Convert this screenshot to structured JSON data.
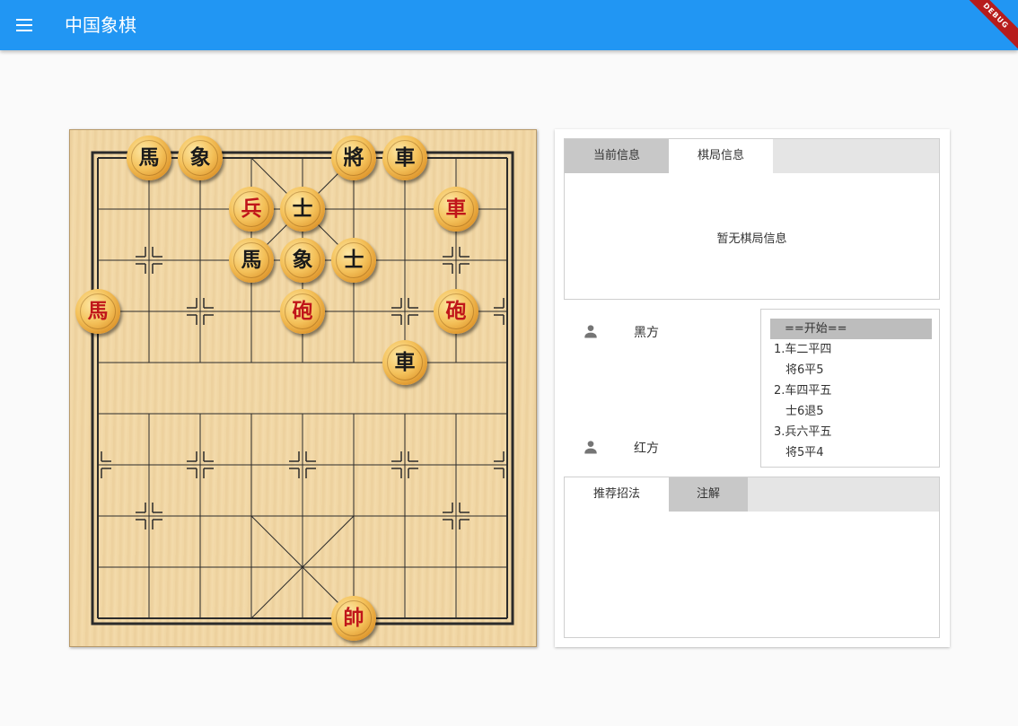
{
  "app": {
    "title": "中国象棋",
    "debug_banner": "DEBUG"
  },
  "board": {
    "pieces": [
      {
        "char": "馬",
        "side": "black",
        "col": 1,
        "row": 0
      },
      {
        "char": "象",
        "side": "black",
        "col": 2,
        "row": 0
      },
      {
        "char": "將",
        "side": "black",
        "col": 5,
        "row": 0
      },
      {
        "char": "車",
        "side": "black",
        "col": 6,
        "row": 0
      },
      {
        "char": "兵",
        "side": "red",
        "col": 3,
        "row": 1
      },
      {
        "char": "士",
        "side": "black",
        "col": 4,
        "row": 1
      },
      {
        "char": "車",
        "side": "red",
        "col": 7,
        "row": 1
      },
      {
        "char": "馬",
        "side": "black",
        "col": 3,
        "row": 2
      },
      {
        "char": "象",
        "side": "black",
        "col": 4,
        "row": 2
      },
      {
        "char": "士",
        "side": "black",
        "col": 5,
        "row": 2
      },
      {
        "char": "馬",
        "side": "red",
        "col": 0,
        "row": 3
      },
      {
        "char": "砲",
        "side": "red",
        "col": 4,
        "row": 3
      },
      {
        "char": "砲",
        "side": "red",
        "col": 7,
        "row": 3
      },
      {
        "char": "車",
        "side": "black",
        "col": 6,
        "row": 4
      },
      {
        "char": "帥",
        "side": "red",
        "col": 5,
        "row": 9
      }
    ]
  },
  "info_tabs": {
    "current": "当前信息",
    "game": "棋局信息",
    "empty_message": "暂无棋局信息"
  },
  "players": {
    "black": "黑方",
    "red": "红方"
  },
  "moves": [
    "==开始==",
    "1.车二平四",
    "将6平5",
    "2.车四平五",
    "士6退5",
    "3.兵六平五",
    "将5平4"
  ],
  "selected_move": 0,
  "bottom_tabs": {
    "recommend": "推荐招法",
    "notes": "注解"
  }
}
